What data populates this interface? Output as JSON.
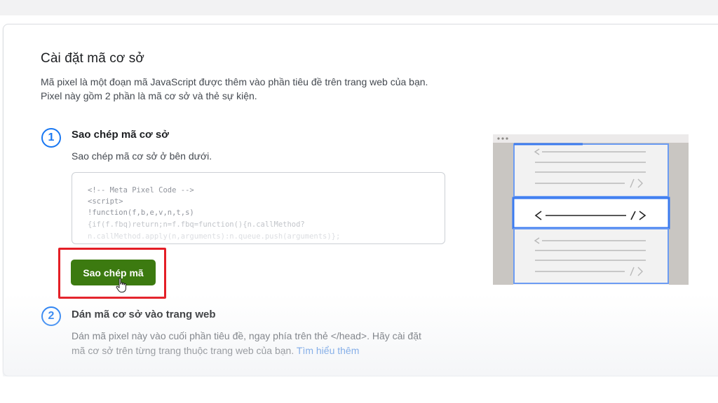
{
  "section": {
    "title": "Cài đặt mã cơ sở",
    "description_line1": "Mã pixel là một đoạn mã JavaScript được thêm vào phần tiêu đề trên trang web của bạn.",
    "description_line2": "Pixel này gồm 2 phần là mã cơ sở và thẻ sự kiện."
  },
  "step1": {
    "number": "1",
    "title": "Sao chép mã cơ sở",
    "text": "Sao chép mã cơ sở ở bên dưới.",
    "code_lines": [
      "<!-- Meta Pixel Code -->",
      "<script>",
      "!function(f,b,e,v,n,t,s)",
      "{if(f.fbq)return;n=f.fbq=function(){n.callMethod?",
      "n.callMethod.apply(n,arguments):n.queue.push(arguments)};"
    ],
    "copy_button_label": "Sao chép mã"
  },
  "step2": {
    "number": "2",
    "title": "Dán mã cơ sở vào trang web",
    "text_line1": "Dán mã pixel này vào cuối phần tiêu đề, ngay phía trên thẻ </head>. Hãy cài đặt",
    "text_line2": "mã cơ sở trên từng trang thuộc trang web của bạn.",
    "learn_more_link": "Tìm hiểu thêm"
  },
  "colors": {
    "accent_blue": "#1877f2",
    "button_green": "#3c7a10",
    "highlight_red": "#e41e26",
    "link_blue": "#216fdb"
  }
}
